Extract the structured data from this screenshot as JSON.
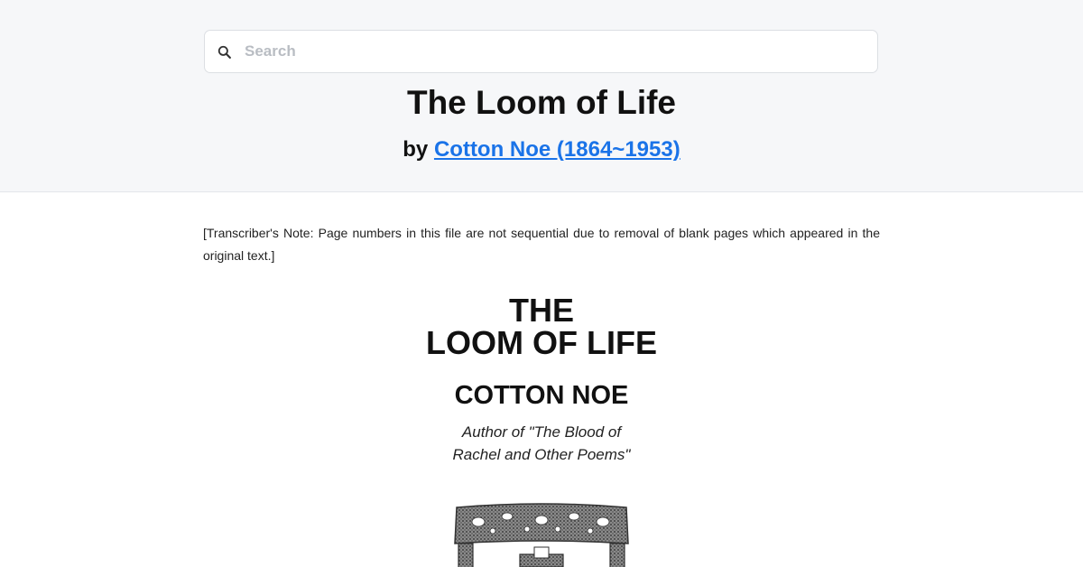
{
  "search": {
    "placeholder": "Search",
    "icon": "search-icon"
  },
  "book": {
    "title": "The Loom of Life",
    "by_prefix": "by",
    "author_link": "Cotton Noe (1864~1953)"
  },
  "content": {
    "transcriber_note": "[Transcriber's Note: Page numbers in this file are not sequential due to removal of blank pages which appeared in the original text.]",
    "title_line1": "THE",
    "title_line2": "LOOM OF LIFE",
    "author": "COTTON NOE",
    "author_of_line1": "Author of \"The Blood of",
    "author_of_line2": "Rachel and Other Poems\""
  },
  "colors": {
    "link": "#1a73e8",
    "header_bg": "#f6f7f9"
  }
}
